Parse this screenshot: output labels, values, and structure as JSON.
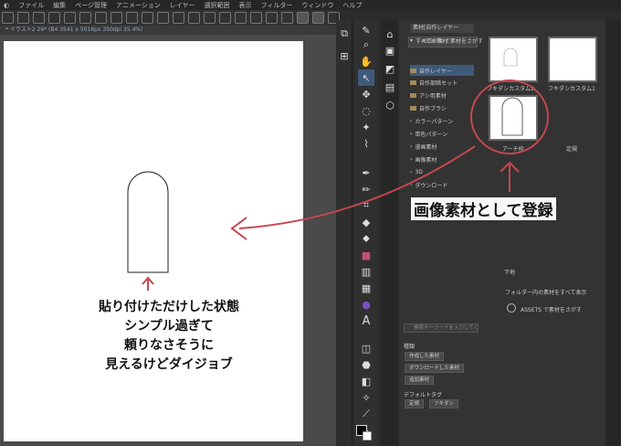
{
  "menu": {
    "items": [
      "ファイル",
      "編集",
      "ページ管理",
      "アニメーション",
      "レイヤー",
      "選択範囲",
      "表示",
      "フィルター",
      "ウィンドウ",
      "ヘルプ"
    ]
  },
  "document": {
    "tab_title": "* イラスト2 26* (B4 3541 x 5016px 350dpi 35.4%)"
  },
  "material_panel": {
    "tab_title": "素材[自作レイヤー",
    "assets_search": "ASSETS で素材をさがす",
    "tree": [
      "すべての素材",
      "自作レイヤー",
      "自作部暗セット",
      "アシ用素材",
      "自作ブラシ",
      "カラーパターン",
      "単色パターン",
      "漫画素材",
      "画像素材",
      "3D",
      "ダウンロード"
    ],
    "thumbs": [
      "フキダシカスタム2",
      "フキダシカスタム1",
      "アーチ枠",
      "定規"
    ],
    "subfolder": "下地",
    "show_all": "フォルダー内の素材をすべて表示",
    "assets_btn": "ASSETS で素材をさがす",
    "search_placeholder": "検索キーワードを入力してください",
    "section_label": "種類",
    "filters": [
      "作成した素材",
      "ダウンロードした素材",
      "追加素材"
    ],
    "default_tag": "デフォルトタグ",
    "tags": [
      "定規",
      "フキダシ"
    ]
  },
  "annotations": {
    "right": "画像素材として登録",
    "left": [
      "貼り付けただけした状態",
      "シンプル過ぎて",
      "頼りなさそうに",
      "見えるけどダイジョブ"
    ]
  },
  "colors": {
    "accent": "#c4474e",
    "selection": "#3f5a7a",
    "panel_bg": "#333333"
  }
}
